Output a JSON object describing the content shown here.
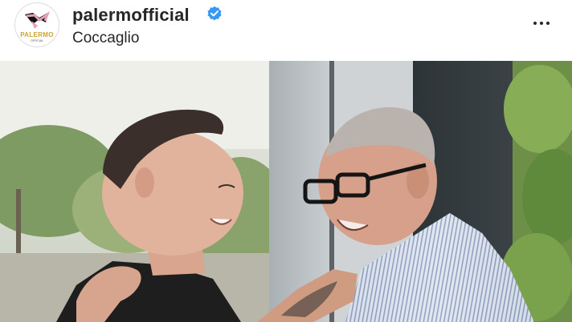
{
  "post": {
    "username": "palermofficial",
    "location": "Coccaglio",
    "avatar_label": "PALERMO",
    "avatar_sub": "OFFICIAL",
    "verified_icon": "verified-badge-icon",
    "more_icon": "more-options-icon",
    "accent_color": "#3897f0",
    "brand_color": "#c9a43a"
  }
}
